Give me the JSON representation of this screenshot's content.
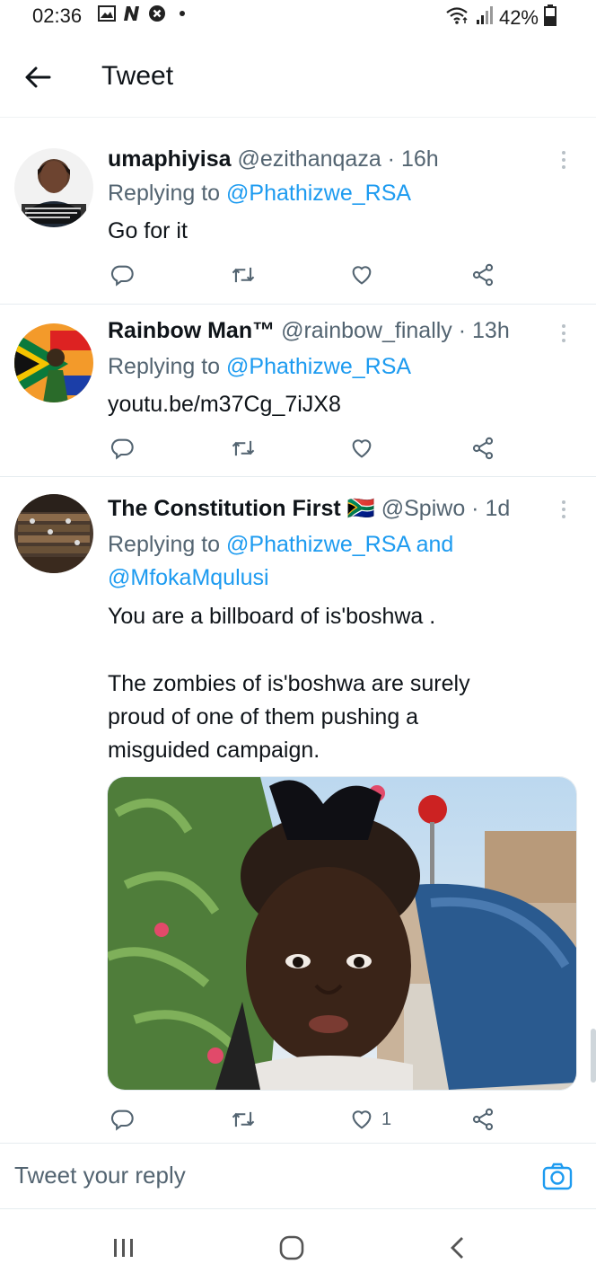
{
  "status_bar": {
    "time": "02:36",
    "battery": "42%",
    "icons": [
      "gallery-icon",
      "n-notification-icon",
      "shield-x-icon",
      "dot-icon",
      "wifi-icon",
      "signal-icon",
      "battery-icon"
    ]
  },
  "header": {
    "title": "Tweet"
  },
  "tweets": [
    {
      "name": "umaphiyisa",
      "handle": "@ezithanqaza",
      "sep": " · ",
      "time": "16h",
      "replying_prefix": "Replying to ",
      "replying_to": "@Phathizwe_RSA",
      "body": "Go for it",
      "likes": ""
    },
    {
      "name": "Rainbow Man™",
      "handle": "@rainbow_finally",
      "sep": " · ",
      "time": "13h",
      "replying_prefix": "Replying to ",
      "replying_to": "@Phathizwe_RSA",
      "link": "youtu.be/m37Cg_7iJX8",
      "likes": ""
    },
    {
      "name": "The Constitution First",
      "flag": "🇿🇦",
      "handle": "@Spiwo",
      "sep": " · ",
      "time": "1d",
      "replying_prefix": "Replying to ",
      "replying_to": "@Phathizwe_RSA and",
      "replying_to_2": "@MfokaMqulusi",
      "body_1": "You are a billboard of is'boshwa .",
      "body_2": "The zombies of is'boshwa are surely",
      "body_3": "proud of one of them pushing a",
      "body_4": "misguided campaign.",
      "likes": "1"
    }
  ],
  "reply_bar": {
    "placeholder": "Tweet your reply"
  },
  "colors": {
    "accent": "#1d9bf0",
    "text": "#0f1419",
    "muted": "#536471"
  }
}
